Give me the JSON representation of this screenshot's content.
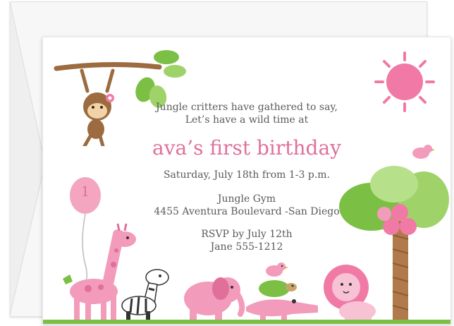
{
  "invitation": {
    "intro_line1": "Jungle critters have gathered to say,",
    "intro_line2": "Let’s have a wild time at",
    "headline": "ava’s first birthday",
    "date_time": "Saturday, July 18th from 1-3 p.m.",
    "venue": "Jungle Gym",
    "address": "4455 Aventura Boulevard -San Diego",
    "rsvp": "RSVP by July 12th",
    "contact": "Jane 555-1212",
    "balloon_number": "1"
  },
  "colors": {
    "accent_pink": "#e0709a",
    "text_gray": "#5a5a5a",
    "leaf_green": "#7cbf45",
    "sun_pink": "#f07aa5"
  },
  "illustrations": [
    "monkey-on-branch-icon",
    "sun-icon",
    "balloon-icon",
    "giraffe-icon",
    "zebra-icon",
    "elephant-icon",
    "crocodile-icon",
    "turtle-icon",
    "bird-icon",
    "lion-icon",
    "palm-tree-icon"
  ]
}
